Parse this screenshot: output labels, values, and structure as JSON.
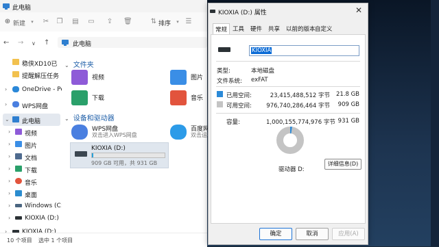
{
  "explorer": {
    "title": "此电脑",
    "toolbar": {
      "new_label": "新建",
      "sort_label": "排序"
    },
    "address": {
      "path": "此电脑"
    },
    "sidebar": {
      "items": [
        {
          "label": "稳侠XD10已",
          "color": "#f2c14e"
        },
        {
          "label": "提醒解压任务",
          "color": "#f2c14e"
        },
        {
          "label": "OneDrive - Pers",
          "color": "#2b88d8"
        },
        {
          "label": "WPS网盘",
          "color": "#4a7fe0"
        },
        {
          "label": "此电脑",
          "color": "#2f7fd0"
        },
        {
          "label": "视频",
          "color": "#8e5bd8"
        },
        {
          "label": "图片",
          "color": "#3a8ee6"
        },
        {
          "label": "文档",
          "color": "#4f6b8f"
        },
        {
          "label": "下载",
          "color": "#2aa06a"
        },
        {
          "label": "音乐",
          "color": "#e2543d"
        },
        {
          "label": "桌面",
          "color": "#2b8ccf"
        },
        {
          "label": "Windows (C:)",
          "color": "#4a6580"
        },
        {
          "label": "KIOXIA (D:)",
          "color": "#2b3135"
        },
        {
          "label": "KIOXIA (D:)",
          "color": "#2b3135"
        }
      ]
    },
    "folders_heading": "文件夹",
    "folders": [
      {
        "name": "视频",
        "color": "#8e5bd8"
      },
      {
        "name": "图片",
        "color": "#3a8ee6"
      },
      {
        "name": "下载",
        "color": "#2aa06a"
      },
      {
        "name": "音乐",
        "color": "#e2543d"
      }
    ],
    "devices_heading": "设备和驱动器",
    "devices": [
      {
        "name": "WPS网盘",
        "sub": "双击进入WPS网盘",
        "color": "#4a7fe0"
      },
      {
        "name": "百度网盘",
        "sub": "双击运行百度网盘",
        "color": "#2c9be8"
      }
    ],
    "drive": {
      "name": "KIOXIA (D:)",
      "sub": "909 GB 可用，共 931 GB",
      "used_fraction": 0.023
    },
    "status": {
      "count": "10 个项目",
      "selected": "选中 1 个项目"
    }
  },
  "dialog": {
    "title": "KIOXIA (D:) 属性",
    "tabs": [
      "常规",
      "工具",
      "硬件",
      "共享",
      "以前的版本",
      "自定义"
    ],
    "name_value": "KIOXIA",
    "type_label": "类型:",
    "type_value": "本地磁盘",
    "fs_label": "文件系统:",
    "fs_value": "exFAT",
    "used_label": "已用空间:",
    "used_bytes": "23,415,488,512 字节",
    "used_gb": "21.8 GB",
    "used_color": "#2b8ad8",
    "free_label": "可用空间:",
    "free_bytes": "976,740,286,464 字节",
    "free_gb": "909 GB",
    "free_color": "#c4c4c4",
    "cap_label": "容量:",
    "cap_bytes": "1,000,155,774,976 字节",
    "cap_gb": "931 GB",
    "drive_label": "驱动器 D:",
    "details_label": "详细信息(D)",
    "used_fraction": 0.023,
    "ok_label": "确定",
    "cancel_label": "取消",
    "apply_label": "应用(A)"
  }
}
